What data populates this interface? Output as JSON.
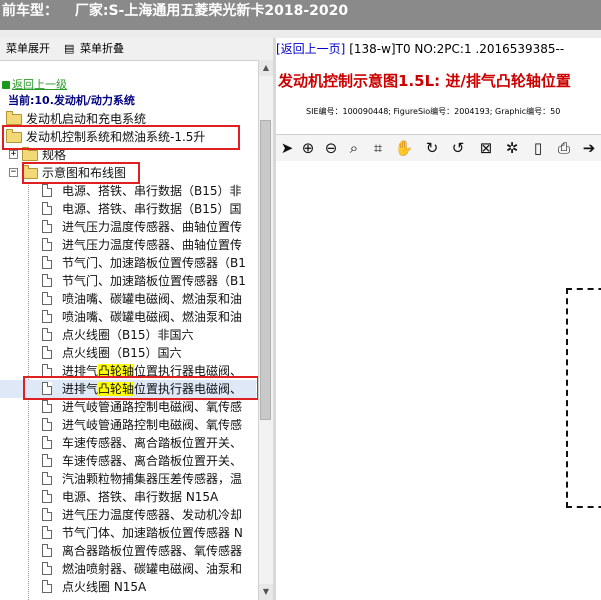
{
  "window": {
    "title_prefix": "前车型：",
    "title_vehicle": "厂家:S-上海通用五菱荣光新卡2018-2020"
  },
  "left_menu": {
    "expand_label": "菜单展开",
    "collapse_label": "菜单折叠"
  },
  "tree": {
    "back_link": "返回上一级",
    "current": "当前:10.发动机/动力系统",
    "folders": [
      {
        "label": "发动机启动和充电系统"
      },
      {
        "label": "发动机控制系统和燃油系统-1.5升"
      },
      {
        "label": "规格"
      },
      {
        "label": "示意图和布线图"
      }
    ],
    "items": [
      {
        "label": "电源、搭铁、串行数据（B15）非"
      },
      {
        "label": "电源、搭铁、串行数据（B15）国"
      },
      {
        "label": "进气压力温度传感器、曲轴位置传"
      },
      {
        "label": "进气压力温度传感器、曲轴位置传"
      },
      {
        "label": "节气门、加速踏板位置传感器（B1"
      },
      {
        "label": "节气门、加速踏板位置传感器（B1"
      },
      {
        "label": "喷油嘴、碳罐电磁阀、燃油泵和油"
      },
      {
        "label": "喷油嘴、碳罐电磁阀、燃油泵和油"
      },
      {
        "label": "点火线圈（B15）非国六"
      },
      {
        "label": "点火线圈（B15）国六"
      },
      {
        "label_pre": "进排气",
        "label_hl": "凸轮轴",
        "label_post": "位置执行器电磁阀、"
      },
      {
        "label_pre": "进排气",
        "label_hl": "凸轮轴",
        "label_post": "位置执行器电磁阀、"
      },
      {
        "label": "进气岐管通路控制电磁阀、氧传感"
      },
      {
        "label": "进气岐管通路控制电磁阀、氧传感"
      },
      {
        "label": "车速传感器、离合踏板位置开关、"
      },
      {
        "label": "车速传感器、离合踏板位置开关、"
      },
      {
        "label": "汽油颗粒物捕集器压差传感器，温"
      },
      {
        "label": "电源、搭铁、串行数据 N15A"
      },
      {
        "label": "进气压力温度传感器、发动机冷却"
      },
      {
        "label": "节气门体、加速踏板位置传感器 N"
      },
      {
        "label": "离合器踏板位置传感器、氧传感器"
      },
      {
        "label": "燃油喷射器、碳罐电磁阀、油泵和"
      },
      {
        "label": "点火线圈 N15A"
      }
    ]
  },
  "right": {
    "back_link": "[返回上一页]",
    "doc_info": "[138-w]T0 NO:2PC:1 .2016539385--",
    "title": "发动机控制示意图1.5L: 进/排气凸轮轴位置",
    "sub_info": "SIE编号：100090448;  FigureSio编号：2004193;  Graphic编号：50"
  },
  "toolbar": [
    {
      "name": "pointer-icon",
      "glyph": "➤"
    },
    {
      "name": "zoom-in-icon",
      "glyph": "⊕"
    },
    {
      "name": "zoom-out-icon",
      "glyph": "⊖"
    },
    {
      "name": "zoom-fit-icon",
      "glyph": "⌕"
    },
    {
      "name": "crop-icon",
      "glyph": "⌗"
    },
    {
      "name": "pan-hand-icon",
      "glyph": "✋"
    },
    {
      "name": "rotate-icon",
      "glyph": "↻"
    },
    {
      "name": "reset-icon",
      "glyph": "↺"
    },
    {
      "name": "fit-page-icon",
      "glyph": "⊠"
    },
    {
      "name": "settings-icon",
      "glyph": "✲"
    },
    {
      "name": "page-icon",
      "glyph": "▯"
    },
    {
      "name": "print-icon",
      "glyph": "⎙"
    },
    {
      "name": "export-icon",
      "glyph": "➔"
    }
  ],
  "colors": {
    "titlebar_bg": "#8a8a8a",
    "highlight": "#ffff00",
    "annotation_box": "#e02020",
    "doc_title": "#cc0000",
    "link": "#0000cc",
    "current_node": "#000080"
  }
}
